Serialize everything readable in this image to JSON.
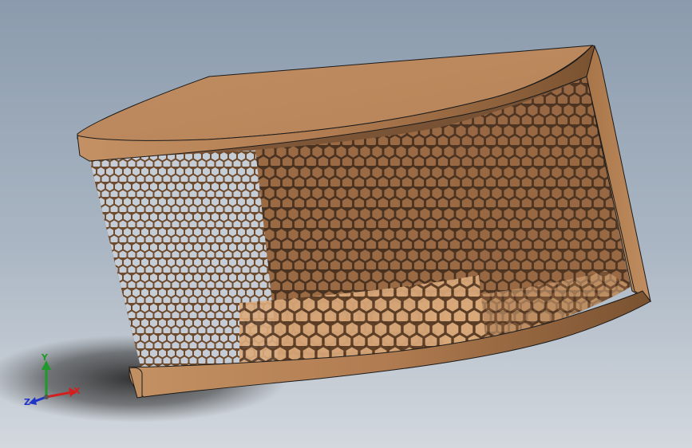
{
  "viewport": {
    "background_top": "#8e9eb0",
    "background_bottom": "#ced4db"
  },
  "model": {
    "material_color": "#bd8a5e",
    "material_dark": "#8a5e38",
    "edge_color": "#1a1a1a",
    "infill_pattern": "hexagonal"
  },
  "triad": {
    "x_label": "X",
    "y_label": "Y",
    "z_label": "Z",
    "x_color": "#d12020",
    "y_color": "#1f9a2a",
    "z_color": "#2034c8"
  }
}
